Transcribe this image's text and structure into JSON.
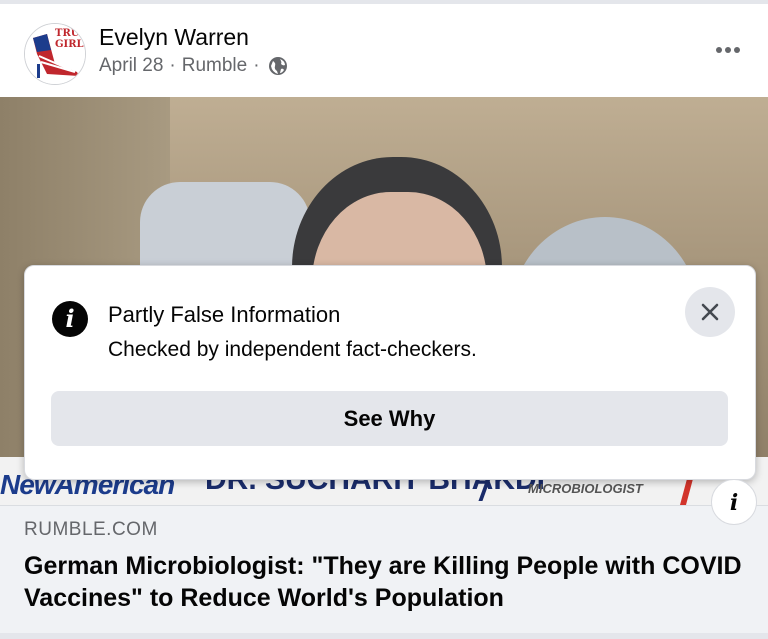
{
  "post": {
    "author": "Evelyn Warren",
    "date": "April 28",
    "source": "Rumble",
    "separator": "·",
    "avatar_text": "TRUMP GIRL",
    "privacy_icon": "globe-icon",
    "more_icon": "more-horizontal-icon"
  },
  "video": {
    "lower_third_left": "NewAmerican",
    "lower_third_mid": "DR. SUCHARIT BHAKDI",
    "lower_third_right": "MICROBIOLOGIST"
  },
  "fact_check": {
    "icon": "info-icon",
    "title": "Partly False Information",
    "subtitle": "Checked by independent fact-checkers.",
    "close_icon": "close-icon",
    "button_label": "See Why"
  },
  "link": {
    "domain": "RUMBLE.COM",
    "title": "German Microbiologist: \"They are Killing People with COVID Vaccines\" to Reduce World's Population"
  },
  "colors": {
    "text_primary": "#050505",
    "text_secondary": "#65676b",
    "button_bg": "#e4e6eb",
    "preview_bg": "#f0f2f5"
  }
}
